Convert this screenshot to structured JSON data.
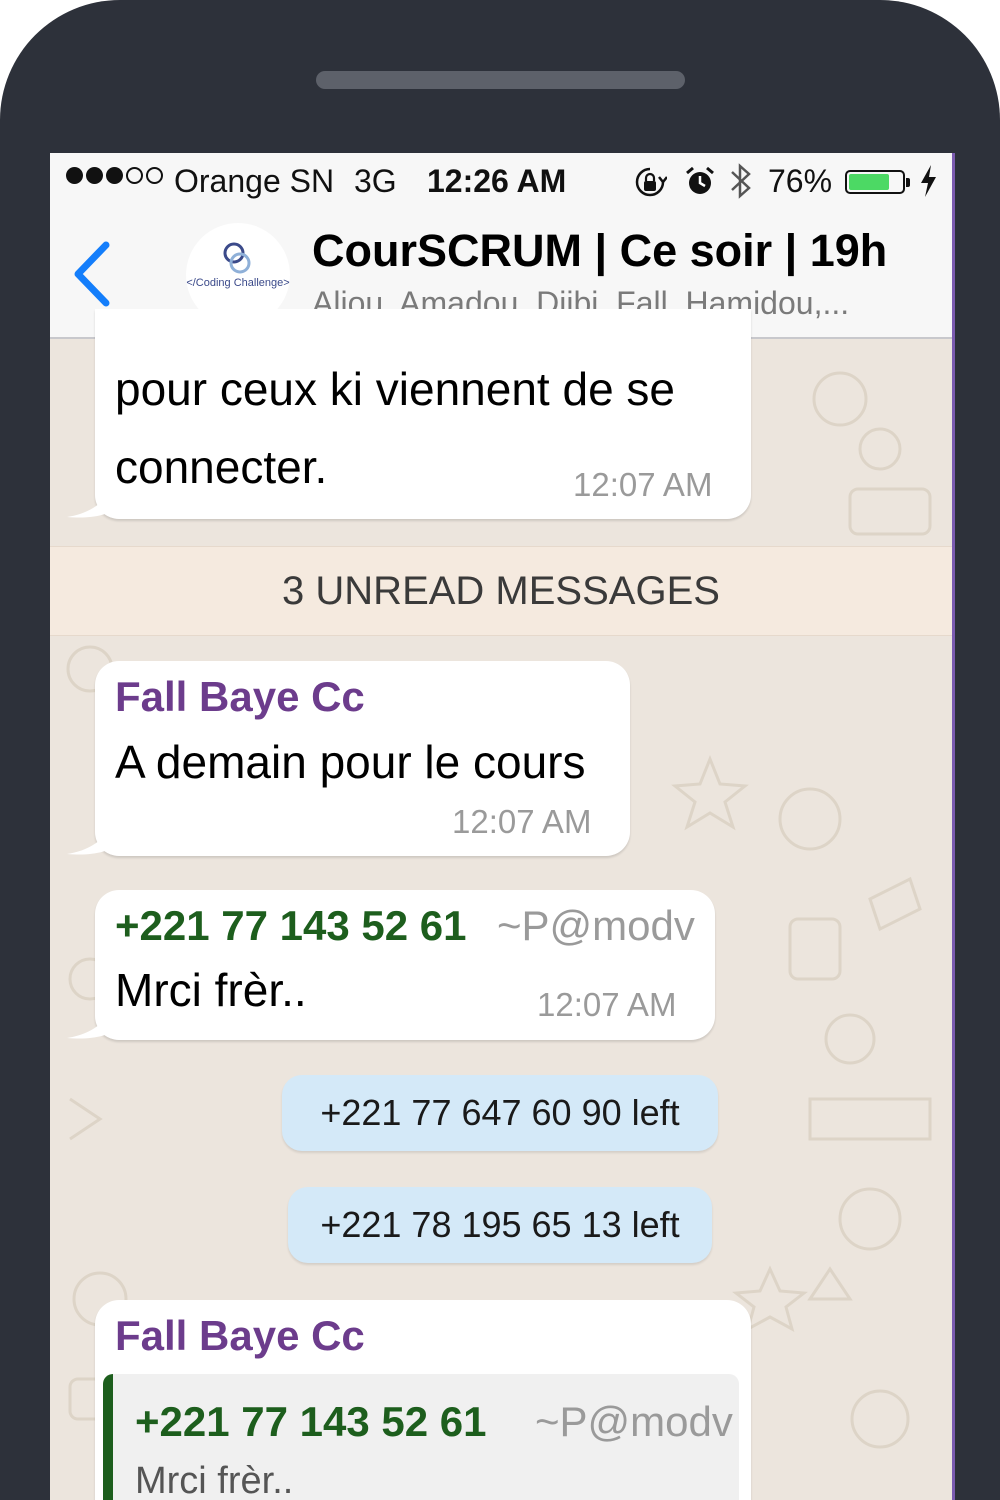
{
  "colors": {
    "ios_blue": "#147efb",
    "group_green": "#1d5e1d",
    "sender_purple": "#6c3c8c",
    "system_bubble": "#d4e9f8",
    "battery_green": "#4cd964"
  },
  "status_bar": {
    "signal_dots": [
      "filled",
      "filled",
      "filled",
      "empty",
      "empty"
    ],
    "carrier": "Orange SN",
    "network": "3G",
    "time": "12:26 AM",
    "icons": [
      "rotation-lock-icon",
      "alarm-icon",
      "bluetooth-icon",
      "battery-icon",
      "charging-icon"
    ],
    "battery_percent": "76%",
    "battery_level": 0.76
  },
  "header": {
    "back_icon": "chevron-left-icon",
    "avatar_logo_text": "</Coding Challenge>",
    "avatar_logo_mark": "CC",
    "title": "CourSCRUM | Ce soir | 19h",
    "subtitle": "Aliou, Amadou, Djibi, Fall, Hamidou,..."
  },
  "messages": {
    "m1": {
      "line1": "pour ceux ki viennent de se",
      "line2": "connecter.",
      "time": "12:07 AM"
    },
    "unread_divider": "3 UNREAD MESSAGES",
    "m2": {
      "sender": "Fall Baye Cc",
      "text": "A demain pour le cours",
      "time": "12:07 AM"
    },
    "m3": {
      "sender": "+221 77 143 52 61",
      "alias": "~P@modv",
      "text": "Mrci frèr..",
      "time": "12:07 AM"
    },
    "sys1": "+221 77 647 60 90 left",
    "sys2": "+221 78 195 65 13 left",
    "m4": {
      "sender": "Fall Baye Cc",
      "quote_sender": "+221 77 143 52 61",
      "quote_alias": "~P@modv",
      "quote_text": "Mrci frèr.."
    }
  }
}
